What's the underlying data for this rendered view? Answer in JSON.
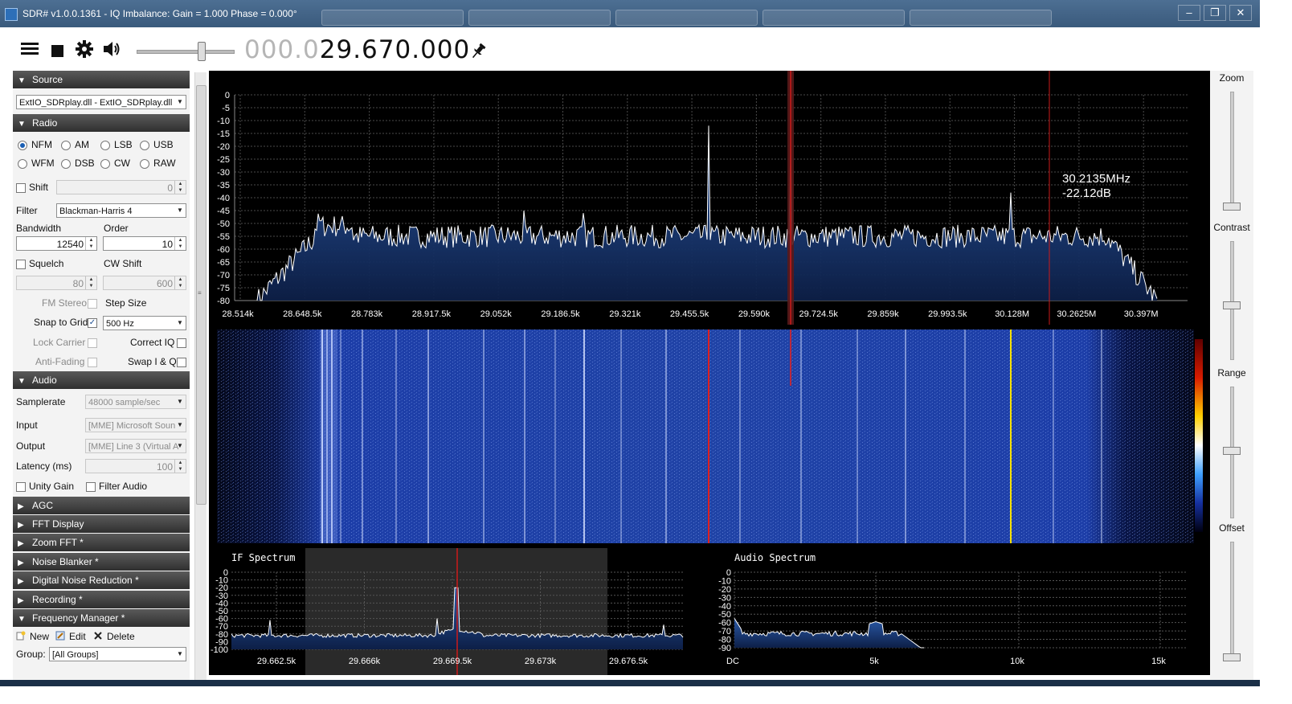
{
  "window": {
    "title": "SDR# v1.0.0.1361 - IQ Imbalance: Gain = 1.000 Phase = 0.000°",
    "controls": {
      "minimize": "–",
      "restore": "❐",
      "close": "✕"
    }
  },
  "toolbar": {
    "icons": [
      "menu-icon",
      "stop-icon",
      "gear-icon",
      "speaker-icon",
      "pin-icon"
    ],
    "frequency_dim": "000.0",
    "frequency_bright": "29.670.000"
  },
  "source": {
    "title": "Source",
    "device": "ExtIO_SDRplay.dll - ExtIO_SDRplay.dll"
  },
  "radio": {
    "title": "Radio",
    "modes": [
      {
        "label": "NFM",
        "selected": true
      },
      {
        "label": "AM",
        "selected": false
      },
      {
        "label": "LSB",
        "selected": false
      },
      {
        "label": "USB",
        "selected": false
      },
      {
        "label": "WFM",
        "selected": false
      },
      {
        "label": "DSB",
        "selected": false
      },
      {
        "label": "CW",
        "selected": false
      },
      {
        "label": "RAW",
        "selected": false
      }
    ],
    "shift_label": "Shift",
    "shift_value": "0",
    "filter_label": "Filter",
    "filter_value": "Blackman-Harris 4",
    "bandwidth_label": "Bandwidth",
    "bandwidth_value": "12540",
    "order_label": "Order",
    "order_value": "10",
    "squelch_label": "Squelch",
    "squelch_value": "80",
    "cwshift_label": "CW Shift",
    "cwshift_value": "600",
    "fmstereo_label": "FM Stereo",
    "stepsize_label": "Step Size",
    "snap_label": "Snap to Grid",
    "snap_checked": "✓",
    "step_value": "500 Hz",
    "lockcarrier_label": "Lock Carrier",
    "correctiq_label": "Correct IQ",
    "antifading_label": "Anti-Fading",
    "swapiq_label": "Swap I & Q"
  },
  "audio": {
    "title": "Audio",
    "samplerate_label": "Samplerate",
    "samplerate_value": "48000 sample/sec",
    "input_label": "Input",
    "input_value": "[MME] Microsoft Soun",
    "output_label": "Output",
    "output_value": "[MME] Line 3 (Virtual A",
    "latency_label": "Latency (ms)",
    "latency_value": "100",
    "unitygain_label": "Unity Gain",
    "filteraudio_label": "Filter Audio"
  },
  "collapsed_sections": [
    "AGC",
    "FFT Display",
    "Zoom FFT *",
    "Noise Blanker *",
    "Digital Noise Reduction *",
    "Recording *"
  ],
  "freq_manager": {
    "title": "Frequency Manager *",
    "new_label": "New",
    "edit_label": "Edit",
    "delete_label": "Delete",
    "group_label": "Group:",
    "group_value": "[All Groups]"
  },
  "right_panel": {
    "zoom_label": "Zoom",
    "contrast_label": "Contrast",
    "range_label": "Range",
    "offset_label": "Offset"
  },
  "spectrum": {
    "y_ticks": [
      "0",
      "-5",
      "-10",
      "-15",
      "-20",
      "-25",
      "-30",
      "-35",
      "-40",
      "-45",
      "-50",
      "-55",
      "-60",
      "-65",
      "-70",
      "-75",
      "-80"
    ],
    "x_ticks": [
      "28.514k",
      "28.648.5k",
      "28.783k",
      "28.917.5k",
      "29.052k",
      "29.186.5k",
      "29.321k",
      "29.455.5k",
      "29.590k",
      "29.724.5k",
      "29.859k",
      "29.993.5k",
      "30.128M",
      "30.2625M",
      "30.397M"
    ],
    "cursor_freq": "30.2135MHz",
    "cursor_db": "-22.12dB",
    "color_fill": "#1c3d7a",
    "color_trace": "#ffffff",
    "color_marker": "#cc1a1a"
  },
  "if_spectrum": {
    "title": "IF Spectrum",
    "y_ticks": [
      "0",
      "-10",
      "-20",
      "-30",
      "-40",
      "-50",
      "-60",
      "-70",
      "-80",
      "-90",
      "-100"
    ],
    "x_ticks": [
      "29.662.5k",
      "29.666k",
      "29.669.5k",
      "29.673k",
      "29.676.5k"
    ]
  },
  "audio_spectrum": {
    "title": "Audio Spectrum",
    "y_ticks": [
      "0",
      "-10",
      "-20",
      "-30",
      "-40",
      "-50",
      "-60",
      "-70",
      "-80",
      "-90"
    ],
    "x_ticks": [
      "DC",
      "5k",
      "10k",
      "15k"
    ]
  }
}
